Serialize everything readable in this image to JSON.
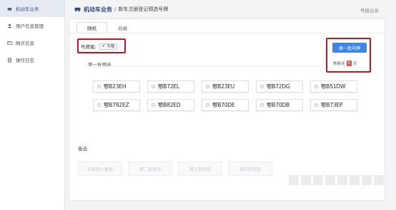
{
  "sidebar": {
    "items": [
      {
        "label": "机动车业务",
        "icon": "car-icon",
        "active": true
      },
      {
        "label": "用户信息管理",
        "icon": "user-icon",
        "active": false
      },
      {
        "label": "网点信息",
        "icon": "card-icon",
        "active": false
      },
      {
        "label": "操作日志",
        "icon": "document-icon",
        "active": false
      }
    ]
  },
  "header": {
    "breadcrumb_main": "机动车业务",
    "breadcrumb_sep": "/",
    "breadcrumb_sub": "新车注册登记预选号牌",
    "right_text": "号段公示"
  },
  "tabs": [
    {
      "label": "随机",
      "active": true
    },
    {
      "label": "自编",
      "active": false
    }
  ],
  "tail": {
    "label": "号牌尾:",
    "value": "不限"
  },
  "actions": {
    "next_button": "换一批号牌",
    "refresh_prefix": "刷新还",
    "refresh_count": "9",
    "refresh_suffix": "次"
  },
  "group": {
    "title": "第一批预选"
  },
  "plates": [
    "鄂B23EH",
    "鄂B72EL",
    "鄂B23EU",
    "鄂B72DG",
    "鄂B51DW",
    "鄂B782EZ",
    "鄂B82ED",
    "鄂B70DE",
    "鄂B70DB",
    "鄂B73EP"
  ],
  "backup": {
    "title": "备选",
    "buttons": [
      "选择加入备选",
      "第二批预选",
      "第三批预选",
      "第四批预选"
    ]
  },
  "colors": {
    "accent": "#3d86e6",
    "highlight": "#c8141c",
    "badge": "#e8524a",
    "brand": "#2e4a7a"
  }
}
